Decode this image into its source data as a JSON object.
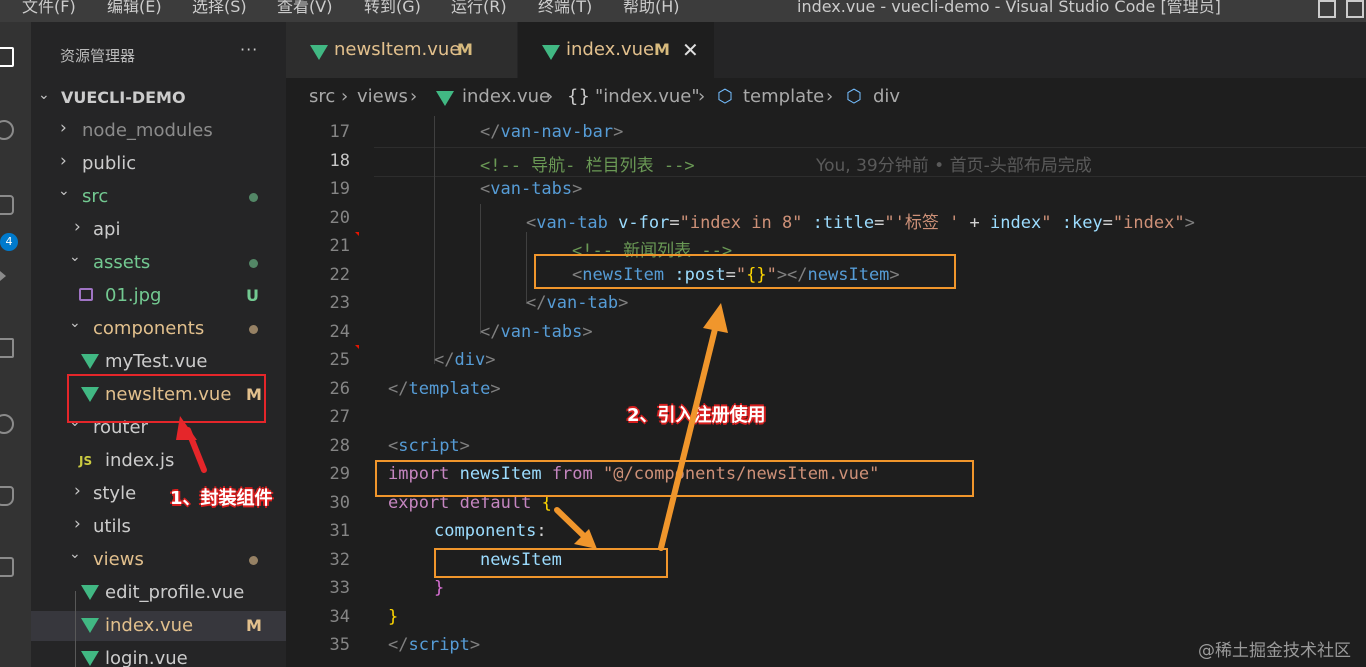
{
  "menu": [
    "文件(F)",
    "编辑(E)",
    "选择(S)",
    "查看(V)",
    "转到(G)",
    "运行(R)",
    "终端(T)",
    "帮助(H)"
  ],
  "window_title": "index.vue - vuecli-demo - Visual Studio Code [管理员]",
  "activity_badge": "4",
  "sidebar": {
    "title": "资源管理器",
    "more": "···",
    "root": "VUECLI-DEMO",
    "items": [
      {
        "label": "node_modules",
        "twisty": "›"
      },
      {
        "label": "public",
        "twisty": "›"
      },
      {
        "label": "src",
        "twisty": "⌄"
      },
      {
        "label": "api",
        "twisty": "›"
      },
      {
        "label": "assets",
        "twisty": "⌄"
      },
      {
        "label": "01.jpg",
        "badge": "U"
      },
      {
        "label": "components",
        "twisty": "⌄"
      },
      {
        "label": "myTest.vue"
      },
      {
        "label": "newsItem.vue",
        "badge": "M"
      },
      {
        "label": "router",
        "twisty": "⌄"
      },
      {
        "label": "index.js",
        "icon_text": "JS"
      },
      {
        "label": "style",
        "twisty": "›"
      },
      {
        "label": "utils",
        "twisty": "›"
      },
      {
        "label": "views",
        "twisty": "⌄"
      },
      {
        "label": "edit_profile.vue"
      },
      {
        "label": "index.vue",
        "badge": "M"
      },
      {
        "label": "login.vue"
      }
    ]
  },
  "tabs": [
    {
      "label": "newsItem.vue",
      "badge": "M"
    },
    {
      "label": "index.vue",
      "badge": "M",
      "close": "✕"
    }
  ],
  "breadcrumb": [
    "src",
    "views",
    "index.vue",
    "{}",
    "\"index.vue\"",
    "template",
    "div"
  ],
  "editor": {
    "line_numbers": [
      "17",
      "18",
      "19",
      "20",
      "21",
      "22",
      "23",
      "24",
      "25",
      "26",
      "27",
      "28",
      "29",
      "30",
      "31",
      "32",
      "33",
      "34",
      "35"
    ],
    "blame": "You, 39分钟前 • 首页-头部布局完成",
    "code": {
      "l17": [
        "</",
        "van-nav-bar",
        ">"
      ],
      "l18": "<!-- 导航- 栏目列表 -->",
      "l19": [
        "<",
        "van-tabs",
        ">"
      ],
      "l20": [
        "<",
        "van-tab",
        " ",
        "v-for",
        "=",
        "\"index in 8\"",
        " ",
        ":title",
        "=",
        "\"",
        "'标签 '",
        " + ",
        "index",
        "\"",
        " ",
        ":key",
        "=",
        "\"index\"",
        ">"
      ],
      "l21": "<!-- 新闻列表 -->",
      "l22": [
        "<",
        "newsItem",
        " ",
        ":post",
        "=",
        "\"",
        "{}",
        "\"",
        "></",
        "newsItem",
        ">"
      ],
      "l23": [
        "</",
        "van-tab",
        ">"
      ],
      "l24": [
        "</",
        "van-tabs",
        ">"
      ],
      "l25": [
        "</",
        "div",
        ">"
      ],
      "l26": [
        "</",
        "template",
        ">"
      ],
      "l28": [
        "<",
        "script",
        ">"
      ],
      "l29": [
        "import",
        " ",
        "newsItem",
        " ",
        "from",
        " ",
        "\"@/components/newsItem.vue\""
      ],
      "l30": [
        "export",
        " ",
        "default",
        " ",
        "{"
      ],
      "l31": [
        "components",
        ":"
      ],
      "l32": "newsItem",
      "l33": "}",
      "l34": "}",
      "l35": [
        "</",
        "script",
        ">"
      ]
    }
  },
  "annotations": {
    "label1": "1、封装组件",
    "label2": "2、引入注册使用"
  },
  "watermark": "@稀土掘金技术社区",
  "colors": {
    "tag": "#569cd6",
    "attr": "#9cdcfe",
    "string": "#ce9178",
    "keyword": "#c586c0",
    "comment": "#6a9955",
    "modified": "#e2c08d",
    "untracked": "#73c991",
    "annotation_orange": "#f0962c",
    "annotation_red": "#e5262a"
  }
}
